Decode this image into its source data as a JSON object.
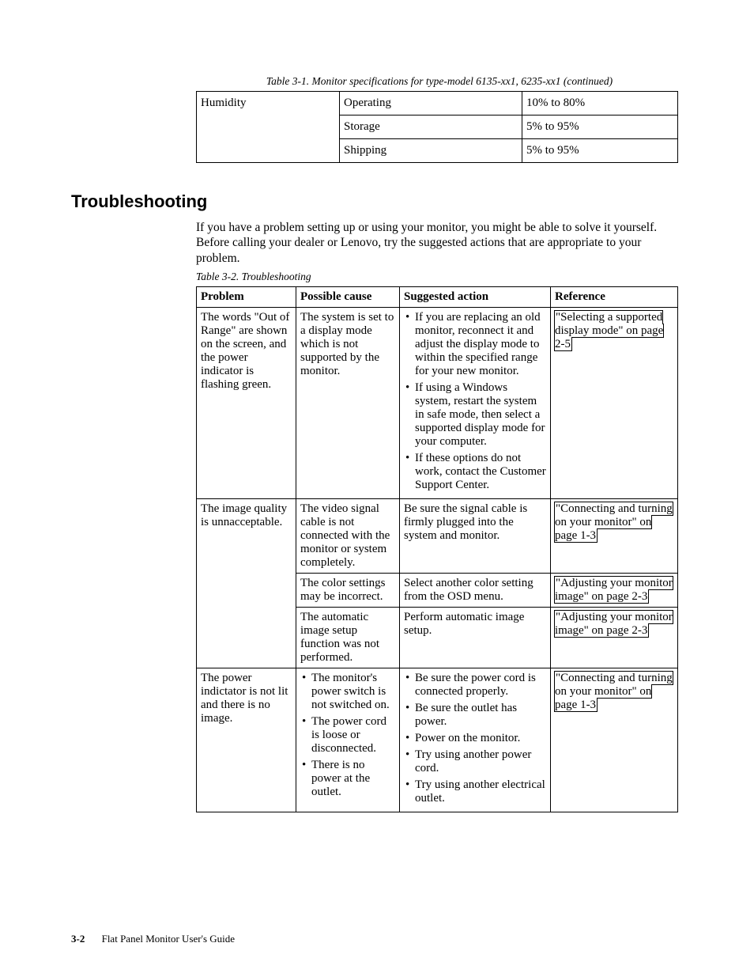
{
  "spec_table": {
    "caption": "Table 3-1. Monitor specifications for type-model 6135-xx1, 6235-xx1  (continued)",
    "row_label": "Humidity",
    "rows": [
      {
        "cond": "Operating",
        "val": "10% to 80%"
      },
      {
        "cond": "Storage",
        "val": "5% to 95%"
      },
      {
        "cond": "Shipping",
        "val": "5% to 95%"
      }
    ]
  },
  "section_heading": "Troubleshooting",
  "intro": "If you have a problem setting up or using your monitor, you might be able to solve it yourself. Before calling your dealer or Lenovo, try the suggested actions that are appropriate to your problem.",
  "trouble_table": {
    "caption": "Table 3-2. Troubleshooting",
    "headers": [
      "Problem",
      "Possible cause",
      "Suggested action",
      "Reference"
    ],
    "rows": [
      {
        "problem": "The words \"Out of Range\" are shown on the screen, and the power indicator is flashing green.",
        "cause_text": "The system is set to a display mode which is not supported by the monitor.",
        "actions": [
          "If you are replacing an old monitor, reconnect it and adjust the display mode to within the specified range for your new monitor.",
          "If using a Windows system, restart the system in safe mode, then select a supported display mode for your computer.",
          "If these options do not work, contact the Customer Support Center."
        ],
        "ref_link": "\"Selecting a supported display mode\" on page 2-5"
      },
      {
        "problem": "The image quality is unnacceptable.",
        "problem_rowspan": 3,
        "cause_text": "The video signal cable is not connected with the monitor or system completely.",
        "action_text": "Be sure the signal cable is firmly plugged into the system and monitor.",
        "ref_link": "\"Connecting and turning on your monitor\" on page 1-3"
      },
      {
        "cause_text": "The color settings may be incorrect.",
        "action_text": "Select another color setting from the OSD menu.",
        "ref_link": "\"Adjusting your monitor image\" on page 2-3"
      },
      {
        "cause_text": "The automatic image setup function was not performed.",
        "action_text": "Perform automatic image setup.",
        "ref_link": "\"Adjusting your monitor image\" on page 2-3"
      },
      {
        "problem": "The power indictator is not lit and there is no image.",
        "cause_list": [
          "The monitor's power switch is not switched on.",
          "The power cord is loose or disconnected.",
          "There is no power at the outlet."
        ],
        "actions": [
          "Be sure the power cord is connected properly.",
          "Be sure the outlet has power.",
          "Power on the monitor.",
          "Try using another power cord.",
          "Try using another electrical outlet."
        ],
        "ref_link": "\"Connecting and turning on your monitor\" on page 1-3"
      }
    ]
  },
  "footer": {
    "pagenum": "3-2",
    "title": "Flat Panel Monitor User's Guide"
  }
}
